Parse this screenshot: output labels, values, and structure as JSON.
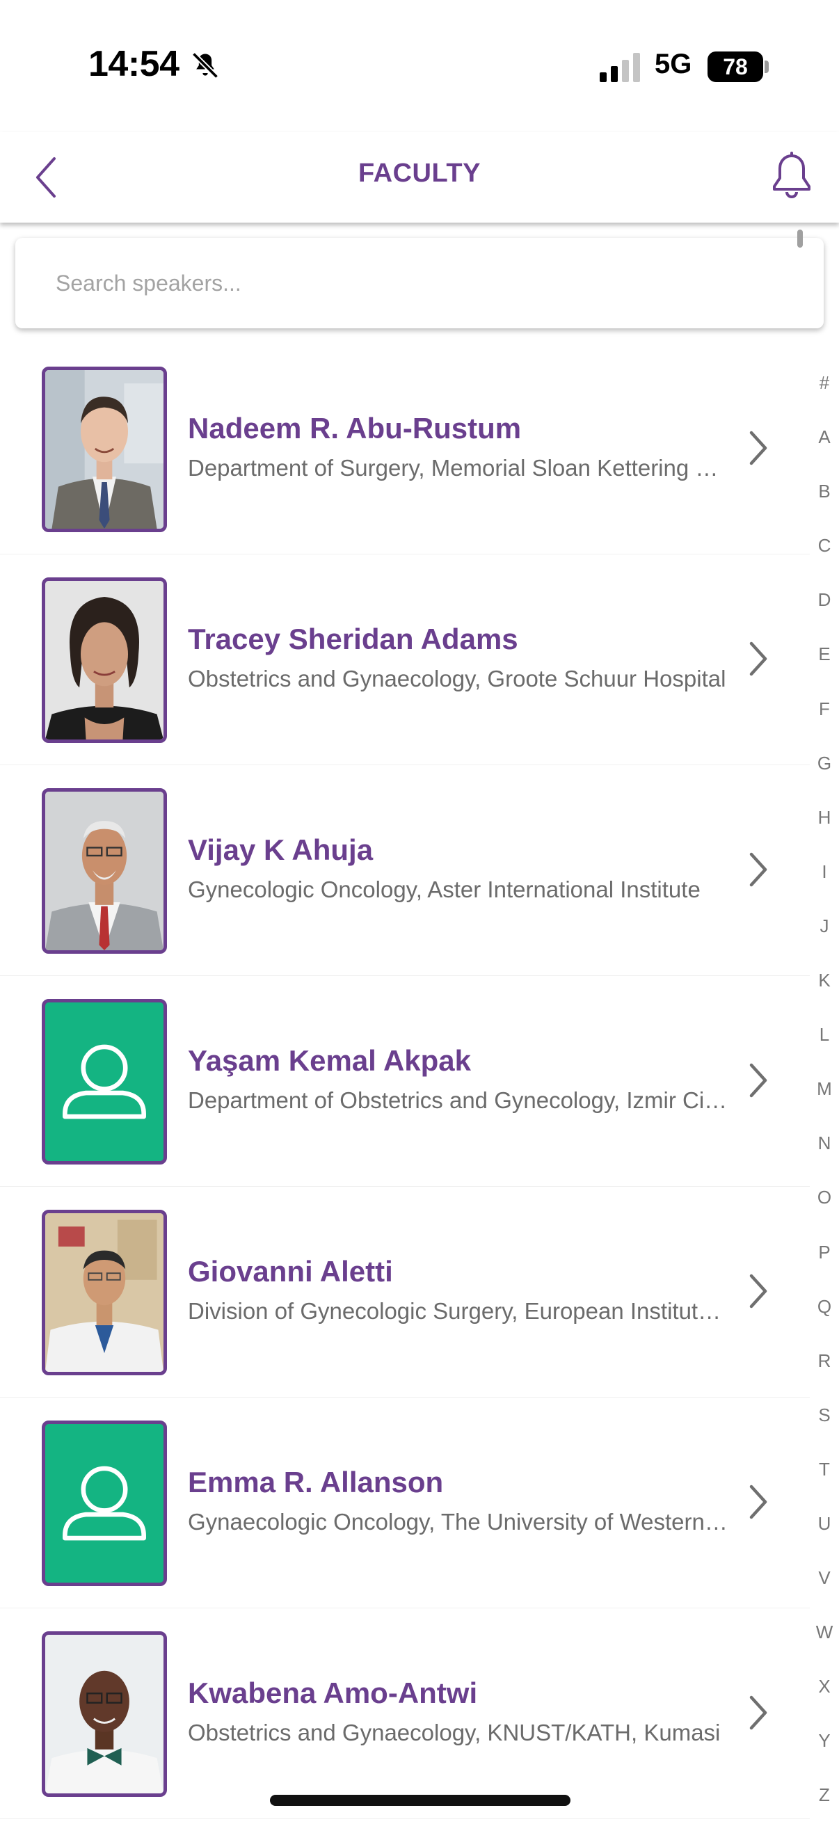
{
  "status_bar": {
    "time": "14:54",
    "network": "5G",
    "battery": "78"
  },
  "nav": {
    "title": "FACULTY"
  },
  "search": {
    "placeholder": "Search speakers..."
  },
  "speakers": [
    {
      "name": "Nadeem R. Abu-Rustum",
      "affiliation": "Department of Surgery, Memorial Sloan Kettering Cancer Center",
      "photo": "photo"
    },
    {
      "name": "Tracey Sheridan Adams",
      "affiliation": "Obstetrics and Gynaecology, Groote Schuur Hospital",
      "photo": "photo"
    },
    {
      "name": "Vijay K Ahuja",
      "affiliation": "Gynecologic Oncology, Aster International Institute",
      "photo": "photo"
    },
    {
      "name": "Yaşam Kemal Akpak",
      "affiliation": "Department of Obstetrics and Gynecology, Izmir City Hospital",
      "photo": "placeholder-person-icon"
    },
    {
      "name": "Giovanni Aletti",
      "affiliation": "Division of Gynecologic Surgery, European Institute of Oncology",
      "photo": "photo"
    },
    {
      "name": "Emma R. Allanson",
      "affiliation": "Gynaecologic Oncology, The University of Western Australia",
      "photo": "placeholder-person-icon"
    },
    {
      "name": "Kwabena Amo-Antwi",
      "affiliation": "Obstetrics and Gynaecology, KNUST/KATH, Kumasi",
      "photo": "photo"
    }
  ],
  "alphabet": [
    "#",
    "A",
    "B",
    "C",
    "D",
    "E",
    "F",
    "G",
    "H",
    "I",
    "J",
    "K",
    "L",
    "M",
    "N",
    "O",
    "P",
    "Q",
    "R",
    "S",
    "T",
    "U",
    "V",
    "W",
    "X",
    "Y",
    "Z"
  ],
  "colors": {
    "brand": "#6a3f8e",
    "placeholder_avatar": "#14b482",
    "affiliation_text": "#6b6b6b"
  }
}
